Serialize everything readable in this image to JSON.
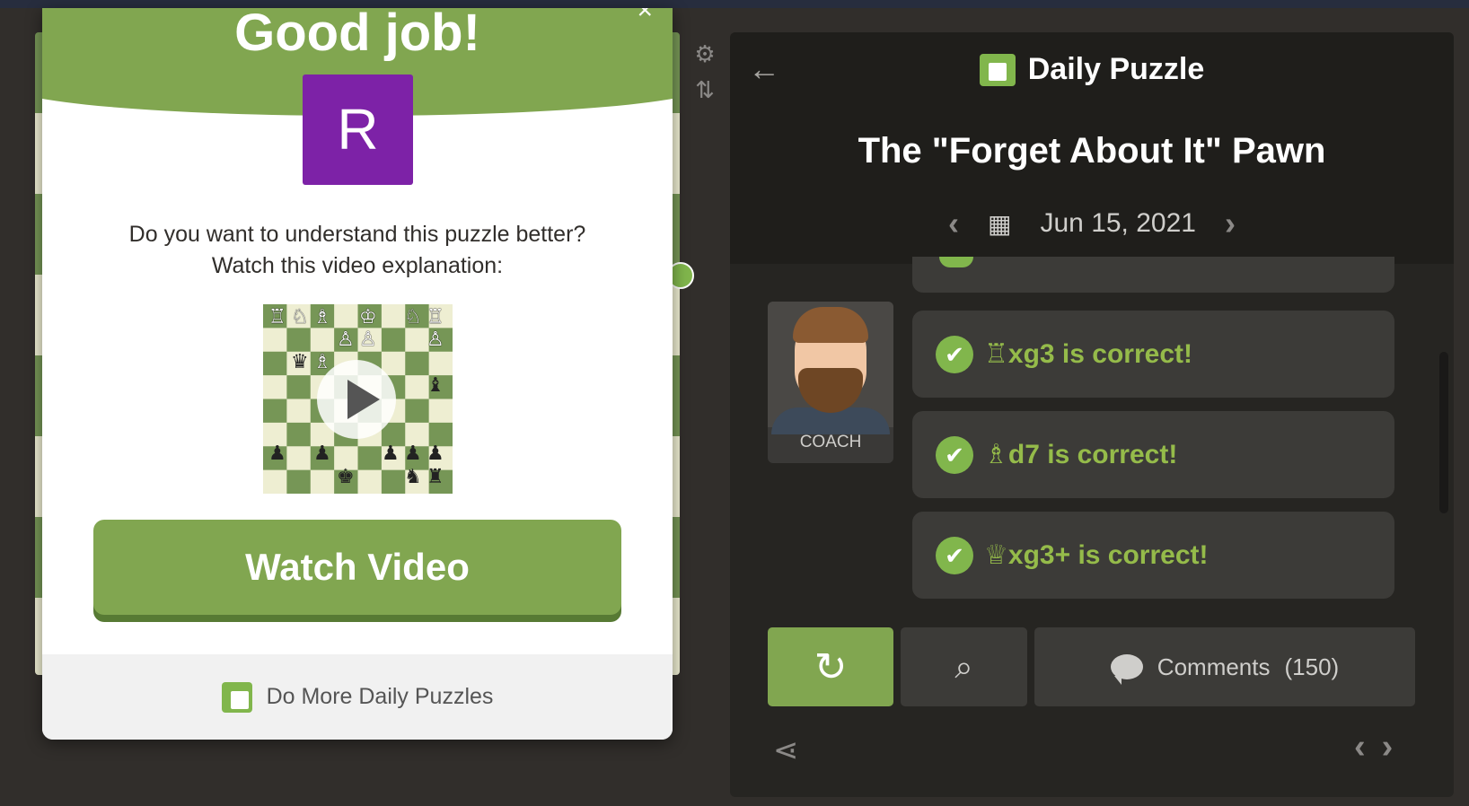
{
  "modal": {
    "title": "Good job!",
    "close_glyph": "×",
    "avatar_letter": "R",
    "prompt_line1": "Do you want to understand this puzzle better?",
    "prompt_line2": "Watch this video explanation:",
    "watch_button": "Watch Video",
    "footer_link": "Do More Daily Puzzles"
  },
  "panel": {
    "heading": "Daily Puzzle",
    "puzzle_title": "The \"Forget About It\" Pawn",
    "date": "Jun 15, 2021",
    "coach_label": "COACH",
    "messages": [
      {
        "text": "♖xg3 is correct!"
      },
      {
        "text": "♗d7 is correct!"
      },
      {
        "text": "♕xg3+ is correct!"
      }
    ],
    "comments_label": "Comments",
    "comments_count": "(150)"
  },
  "colors": {
    "accent_green": "#81a650",
    "correct_text": "#95bb4a",
    "avatar_purple": "#7d22a7",
    "panel_bg": "#262522"
  },
  "icons": [
    "close-icon",
    "gear-icon",
    "flip-board-icon",
    "back-arrow-icon",
    "daily-puzzle-icon",
    "calendar-icon",
    "chevron-left-icon",
    "chevron-right-icon",
    "check-circle-icon",
    "retry-icon",
    "analysis-icon",
    "comment-icon",
    "share-icon",
    "play-icon"
  ]
}
